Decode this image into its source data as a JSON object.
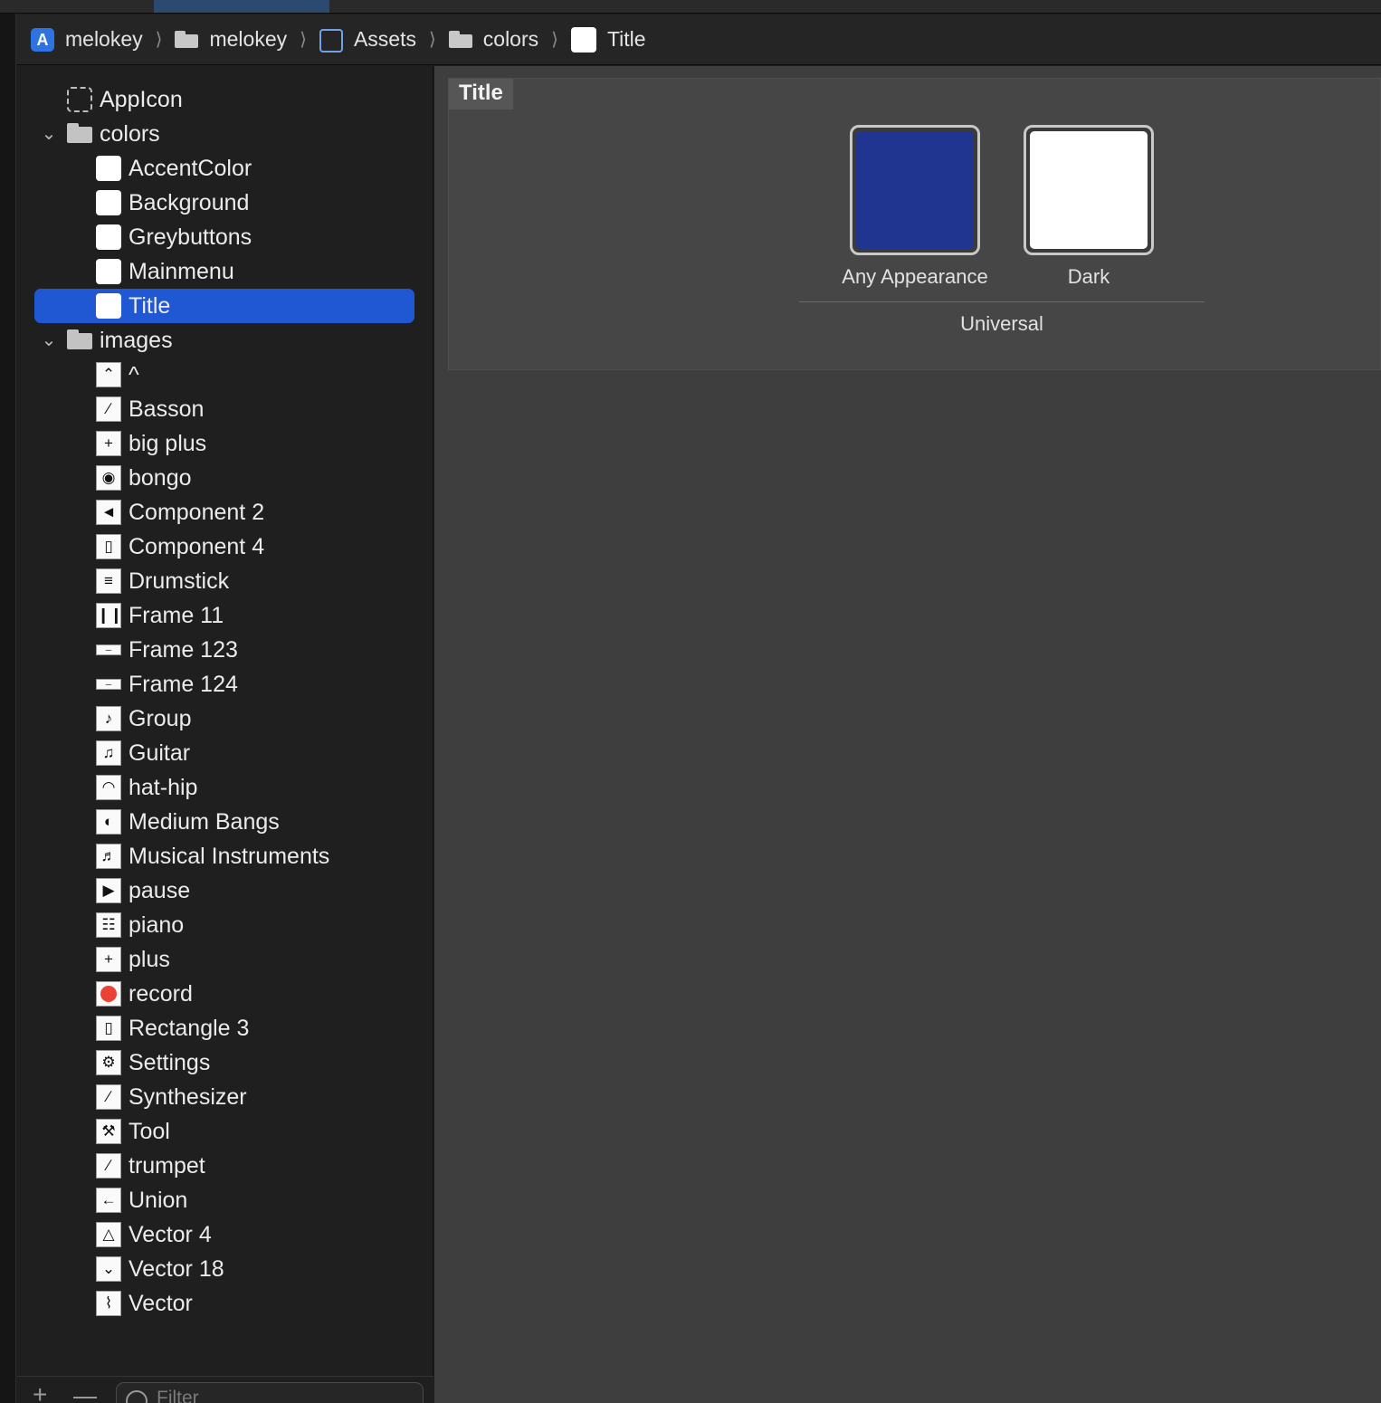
{
  "breadcrumb": [
    {
      "label": "melokey",
      "icon": "app-icon"
    },
    {
      "label": "melokey",
      "icon": "folder-icon"
    },
    {
      "label": "Assets",
      "icon": "asset-catalog-icon"
    },
    {
      "label": "colors",
      "icon": "folder-icon"
    },
    {
      "label": "Title",
      "icon": "color-swatch-icon"
    }
  ],
  "sidebar": {
    "appicon": "AppIcon",
    "colors_folder": "colors",
    "colors": [
      "AccentColor",
      "Background",
      "Greybuttons",
      "Mainmenu",
      "Title"
    ],
    "selected": "Title",
    "images_folder": "images",
    "images": [
      {
        "label": "^",
        "icon": "caret-up-icon"
      },
      {
        "label": "Basson",
        "icon": "bassoon-icon"
      },
      {
        "label": "big plus",
        "icon": "plus-icon"
      },
      {
        "label": "bongo",
        "icon": "bongo-icon"
      },
      {
        "label": "Component 2",
        "icon": "speaker-icon"
      },
      {
        "label": "Component 4",
        "icon": "trash-icon"
      },
      {
        "label": "Drumstick",
        "icon": "drum-icon"
      },
      {
        "label": "Frame 11",
        "icon": "bars-icon"
      },
      {
        "label": "Frame 123",
        "icon": "bar-icon"
      },
      {
        "label": "Frame 124",
        "icon": "bar-icon"
      },
      {
        "label": "Group",
        "icon": "saxophone-icon"
      },
      {
        "label": "Guitar",
        "icon": "guitar-icon"
      },
      {
        "label": "hat-hip",
        "icon": "hat-icon"
      },
      {
        "label": "Medium Bangs",
        "icon": "hair-icon"
      },
      {
        "label": "Musical Instruments",
        "icon": "instruments-icon"
      },
      {
        "label": "pause",
        "icon": "play-icon"
      },
      {
        "label": "piano",
        "icon": "piano-icon"
      },
      {
        "label": "plus",
        "icon": "plus-icon"
      },
      {
        "label": "record",
        "icon": "record-icon"
      },
      {
        "label": "Rectangle 3",
        "icon": "rectangle-icon"
      },
      {
        "label": "Settings",
        "icon": "gear-icon"
      },
      {
        "label": "Synthesizer",
        "icon": "synthesizer-icon"
      },
      {
        "label": "Tool",
        "icon": "wrench-icon"
      },
      {
        "label": "trumpet",
        "icon": "trumpet-icon"
      },
      {
        "label": "Union",
        "icon": "arrow-left-icon"
      },
      {
        "label": "Vector 4",
        "icon": "metronome-icon"
      },
      {
        "label": "Vector 18",
        "icon": "chevron-down-icon"
      },
      {
        "label": "Vector",
        "icon": "accordion-icon"
      }
    ],
    "filter_placeholder": "Filter"
  },
  "editor": {
    "set_title": "Title",
    "appearances": [
      {
        "label": "Any Appearance",
        "color": "#1f3590"
      },
      {
        "label": "Dark",
        "color": "#ffffff"
      }
    ],
    "device_label": "Universal"
  },
  "colors": {
    "accent": "#2058d4",
    "record": "#ea4335"
  }
}
